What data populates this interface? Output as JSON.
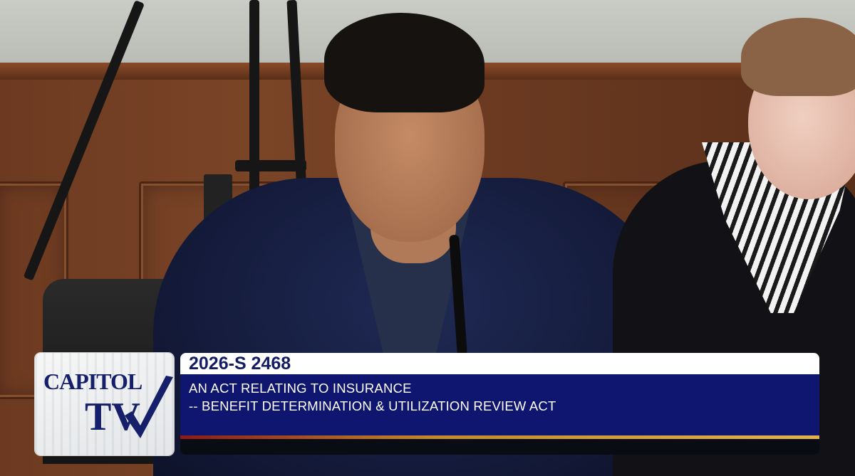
{
  "logo": {
    "line1": "CAPITOL",
    "line2": "TV"
  },
  "lower_third": {
    "bill_number": "2026-S 2468",
    "description_line1": "AN ACT RELATING TO INSURANCE",
    "description_line2": "-- BENEFIT DETERMINATION & UTILIZATION REVIEW ACT"
  },
  "colors": {
    "banner_navy": "#0f1670",
    "title_text": "#141d63",
    "accent_gold": "#e2b24b"
  }
}
